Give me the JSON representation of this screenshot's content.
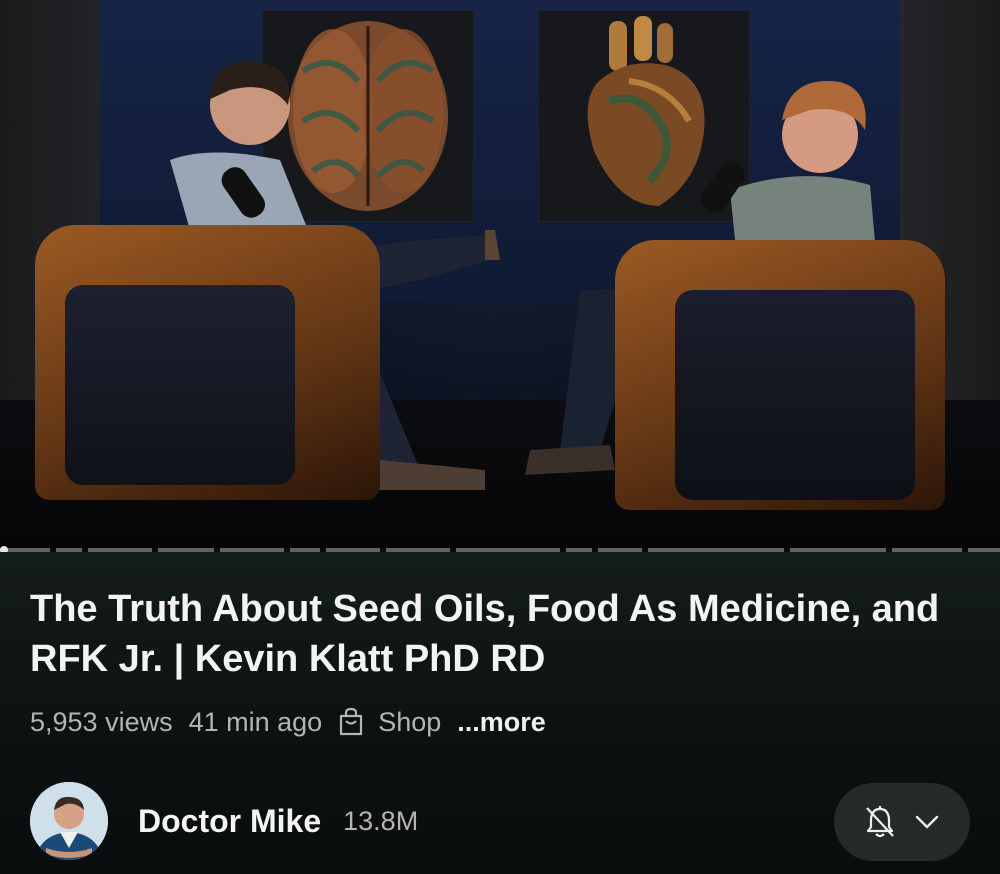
{
  "video": {
    "thumbnail_description_icons": [
      "brain-art-icon",
      "heart-art-icon"
    ],
    "progress_fraction": 0.004
  },
  "info": {
    "title": "The Truth About Seed Oils, Food As Medicine, and RFK Jr. | Kevin Klatt PhD RD",
    "views": "5,953 views",
    "time_ago": "41 min ago",
    "shop_label": "Shop",
    "more_label": "...more"
  },
  "channel": {
    "name": "Doctor Mike",
    "subscribers": "13.8M",
    "avatar_icon": "doctor-avatar",
    "subscribe_icon": "bell-off-icon",
    "dropdown_icon": "chevron-down-icon"
  },
  "colors": {
    "background": "#0b0d0d",
    "subscribe_pill": "#262a2a",
    "muted_text": "#b4b4b4"
  }
}
